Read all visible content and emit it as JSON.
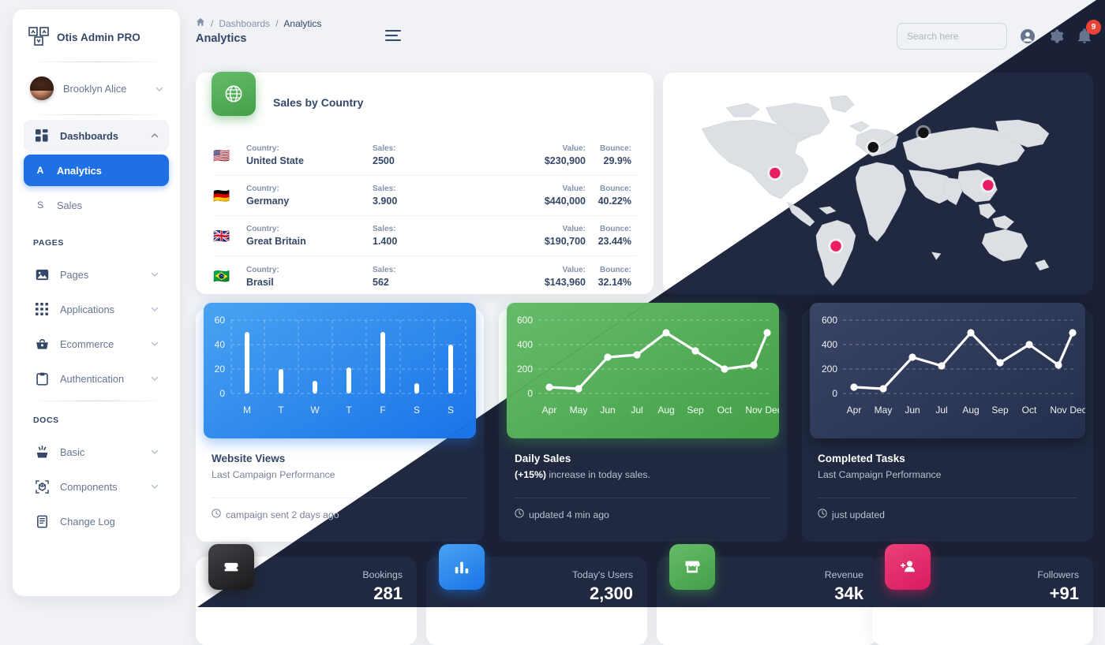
{
  "brand": {
    "name": "Otis Admin PRO",
    "logo_icon": "otis-logo-icon"
  },
  "profile": {
    "name": "Brooklyn Alice",
    "chevron_icon": "chevron-down-icon",
    "avatar_icon": "avatar"
  },
  "sidebar": {
    "dashboards": {
      "label": "Dashboards",
      "icon": "dashboard-grid-icon",
      "chevron": "chevron-up-icon"
    },
    "sub_items": [
      {
        "letter": "A",
        "label": "Analytics",
        "active": true
      },
      {
        "letter": "S",
        "label": "Sales",
        "active": false
      }
    ],
    "section_pages": "PAGES",
    "pages_items": [
      {
        "label": "Pages",
        "icon": "image-icon",
        "chevron": "chevron-down-icon"
      },
      {
        "label": "Applications",
        "icon": "apps-grid-icon",
        "chevron": "chevron-down-icon"
      },
      {
        "label": "Ecommerce",
        "icon": "basket-icon",
        "chevron": "chevron-down-icon"
      },
      {
        "label": "Authentication",
        "icon": "clipboard-icon",
        "chevron": "chevron-down-icon"
      }
    ],
    "section_docs": "DOCS",
    "docs_items": [
      {
        "label": "Basic",
        "icon": "spark-box-icon",
        "chevron": "chevron-down-icon"
      },
      {
        "label": "Components",
        "icon": "cube-frame-icon",
        "chevron": "chevron-down-icon"
      },
      {
        "label": "Change Log",
        "icon": "changelog-file-icon",
        "chevron": ""
      }
    ]
  },
  "topbar": {
    "home_icon": "home-icon",
    "crumb_sep": "/",
    "crumb_1": "Dashboards",
    "crumb_2": "Analytics",
    "page_title": "Analytics",
    "burger_icon": "hamburger-menu-icon",
    "search_placeholder": "Search here",
    "search_value": "",
    "account_icon": "account-circle-icon",
    "settings_icon": "gear-icon",
    "bell_icon": "bell-icon",
    "notification_count": "9"
  },
  "sales_by_country": {
    "title": "Sales by Country",
    "icon": "globe-icon",
    "keys": {
      "country": "Country:",
      "sales": "Sales:",
      "value": "Value:",
      "bounce": "Bounce:"
    },
    "rows": [
      {
        "flag": "flag-us",
        "country": "United State",
        "sales": "2500",
        "value": "$230,900",
        "bounce": "29.9%"
      },
      {
        "flag": "flag-de",
        "country": "Germany",
        "sales": "3.900",
        "value": "$440,000",
        "bounce": "40.22%"
      },
      {
        "flag": "flag-gb",
        "country": "Great Britain",
        "sales": "1.400",
        "value": "$190,700",
        "bounce": "23.44%"
      },
      {
        "flag": "flag-br",
        "country": "Brasil",
        "sales": "562",
        "value": "$143,960",
        "bounce": "32.14%"
      }
    ]
  },
  "map": {
    "name": "world-map",
    "markers": [
      {
        "label": "United State",
        "color": "#e91e63"
      },
      {
        "label": "Brasil",
        "color": "#e91e63"
      },
      {
        "label": "Germany",
        "color": "#111111"
      },
      {
        "label": "Russia",
        "color": "#111111"
      },
      {
        "label": "China",
        "color": "#e91e63"
      }
    ]
  },
  "cards": [
    {
      "id": "website-views",
      "title": "Website Views",
      "subtitle": "Last Campaign Performance",
      "footer": "campaign sent 2 days ago",
      "footer_icon": "clock-icon",
      "accent": "#1a73e8"
    },
    {
      "id": "daily-sales",
      "title": "Daily Sales",
      "subtitle_bold": "(+15%)",
      "subtitle_rest": " increase in today sales.",
      "footer": "updated 4 min ago",
      "footer_icon": "clock-icon",
      "accent": "#43a047"
    },
    {
      "id": "completed-tasks",
      "title": "Completed Tasks",
      "subtitle": "Last Campaign Performance",
      "footer": "just updated",
      "footer_icon": "clock-icon",
      "accent": "#242f4d"
    }
  ],
  "stats": [
    {
      "label": "Bookings",
      "value": "281",
      "icon": "sofa-icon",
      "color": "dark"
    },
    {
      "label": "Today's Users",
      "value": "2,300",
      "icon": "bar-chart-icon",
      "color": "blue"
    },
    {
      "label": "Revenue",
      "value": "34k",
      "icon": "store-icon",
      "color": "green"
    },
    {
      "label": "Followers",
      "value": "+91",
      "icon": "person-add-icon",
      "color": "pink"
    }
  ],
  "chart_data": [
    {
      "type": "bar",
      "id": "website-views",
      "title": "Website Views",
      "categories": [
        "M",
        "T",
        "W",
        "T",
        "F",
        "S",
        "S"
      ],
      "values": [
        50,
        20,
        10,
        21,
        50,
        8,
        40
      ],
      "yticks": [
        0,
        20,
        40,
        60
      ],
      "ylim": [
        0,
        60
      ],
      "xlabel": "",
      "ylabel": "",
      "grid": true,
      "bar_color": "#ffffff",
      "bg_gradient": [
        "#49a3f1",
        "#1a73e8"
      ]
    },
    {
      "type": "line",
      "id": "daily-sales",
      "title": "Daily Sales",
      "categories": [
        "Apr",
        "May",
        "Jun",
        "Jul",
        "Aug",
        "Sep",
        "Oct",
        "Nov",
        "Dec"
      ],
      "values": [
        50,
        40,
        300,
        320,
        500,
        350,
        200,
        230,
        500
      ],
      "yticks": [
        0,
        200,
        400,
        600
      ],
      "ylim": [
        0,
        600
      ],
      "xlabel": "",
      "ylabel": "",
      "grid": true,
      "line_color": "#ffffff",
      "bg_gradient": [
        "#66bb6a",
        "#43a047"
      ]
    },
    {
      "type": "line",
      "id": "completed-tasks",
      "title": "Completed Tasks",
      "categories": [
        "Apr",
        "May",
        "Jun",
        "Jul",
        "Aug",
        "Sep",
        "Oct",
        "Nov",
        "Dec"
      ],
      "values": [
        50,
        40,
        300,
        220,
        500,
        250,
        400,
        230,
        500
      ],
      "yticks": [
        0,
        200,
        400,
        600
      ],
      "ylim": [
        0,
        600
      ],
      "xlabel": "",
      "ylabel": "",
      "grid": true,
      "line_color": "#ffffff",
      "bg_gradient": [
        "#3a4566",
        "#242f4d"
      ]
    }
  ]
}
